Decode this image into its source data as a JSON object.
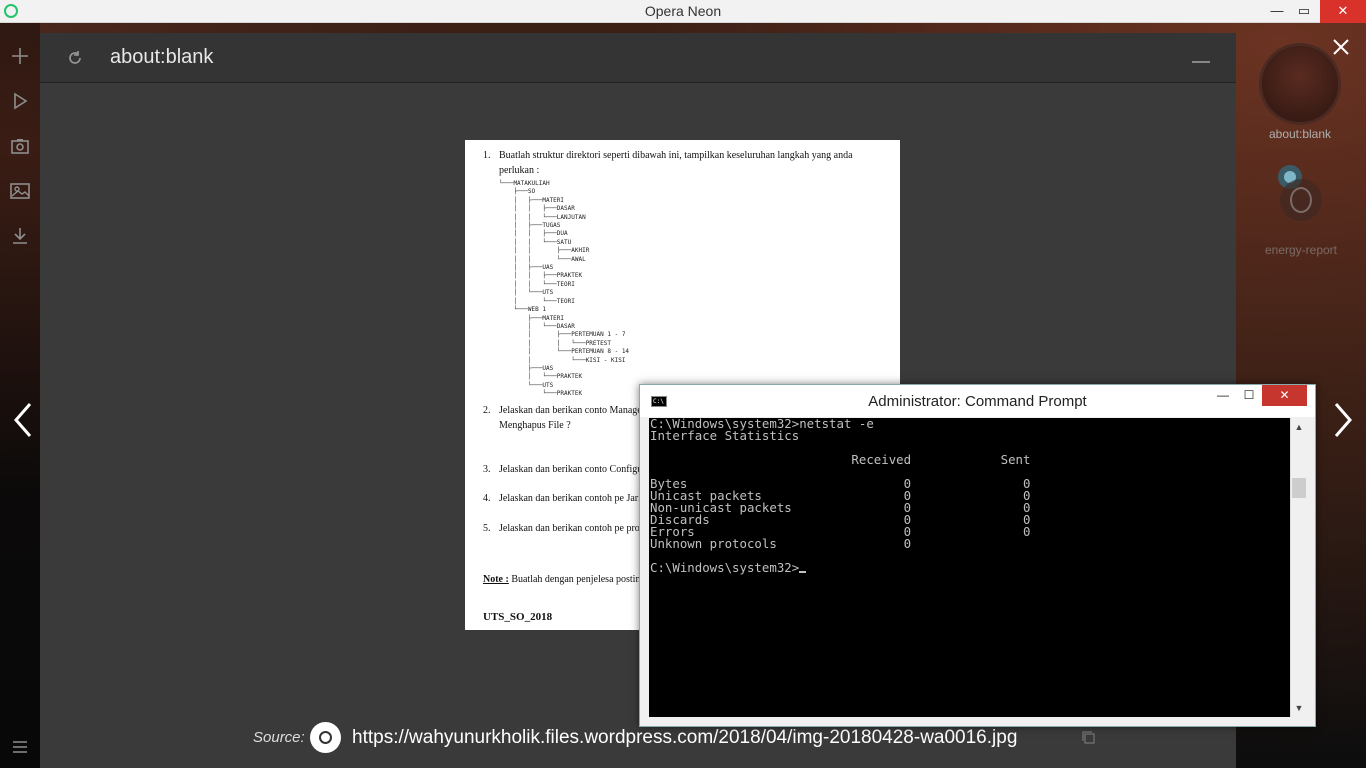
{
  "window": {
    "title": "Opera Neon",
    "min_glyph": "—",
    "max_glyph": "▭",
    "close_glyph": "✕"
  },
  "sidebar": {
    "icons": [
      "plus-icon",
      "play-icon",
      "camera-icon",
      "gallery-icon",
      "download-icon",
      "menu-icon"
    ]
  },
  "addressbar": {
    "url": "about:blank"
  },
  "document": {
    "q1_num": "1.",
    "q1_text": "Buatlah struktur direktori seperti dibawah ini, tampilkan keseluruhan langkah yang anda perlukan :",
    "tree": "└───MATAKULIAH\n    ├───SO\n    │   ├───MATERI\n    │   │   ├───DASAR\n    │   │   └───LANJUTAN\n    │   ├───TUGAS\n    │   │   ├───DUA\n    │   │   └───SATU\n    │   │       ├───AKHIR\n    │   │       └───AWAL\n    │   ├───UAS\n    │   │   ├───PRAKTEK\n    │   │   └───TEORI\n    │   └───UTS\n    │       └───TEORI\n    └───WEB 1\n        ├───MATERI\n        │   └───DASAR\n        │       ├───PERTEMUAN 1 - 7\n        │       │   └───PRETEST\n        │       └───PERTEMUAN 8 - 14\n        │           └───KISI - KISI\n        ├───UAS\n        │   └───PRAKTEK\n        └───UTS\n            └───PRAKTEK",
    "q2_num": "2.",
    "q2_text": "Jelaskan dan berikan conto Management) seperti Berpind Direktori Mengcopy / Menya Menghapus File ?",
    "q3_num": "3.",
    "q3_text": "Jelaskan dan berikan conto Configuration seperti Hak Logi",
    "q4_num": "4.",
    "q4_text": "Jelaskan dan berikan contoh pe Jaringan?",
    "q5_num": "5.",
    "q5_text": "Jelaskan dan berikan contoh pe prompt yang anda ketahui mini",
    "note_label": "Note :",
    "note_text": " Buatlah dengan penjelesa posting beserta print screen has kemudian link web/blog silahkan",
    "uts": "UTS_SO_2018"
  },
  "nav": {
    "prev_glyph": "‹",
    "next_glyph": "›"
  },
  "tabs": [
    {
      "label": "about:blank"
    },
    {
      "label": "energy-report"
    }
  ],
  "close_glyph": "✕",
  "source": {
    "label": "Source:",
    "url": "https://wahyunurkholik.files.wordpress.com/2018/04/img-20180428-wa0016.jpg"
  },
  "cmd": {
    "title": "Administrator: Command Prompt",
    "icon_text": "C:\\",
    "min_glyph": "—",
    "max_glyph": "☐",
    "close_glyph": "✕",
    "lines": [
      "C:\\Windows\\system32>netstat -e",
      "Interface Statistics",
      "",
      "                           Received            Sent",
      "",
      "Bytes                             0               0",
      "Unicast packets                   0               0",
      "Non-unicast packets               0               0",
      "Discards                          0               0",
      "Errors                            0               0",
      "Unknown protocols                 0",
      "",
      "C:\\Windows\\system32>"
    ],
    "scroll_up": "▲",
    "scroll_down": "▼"
  }
}
